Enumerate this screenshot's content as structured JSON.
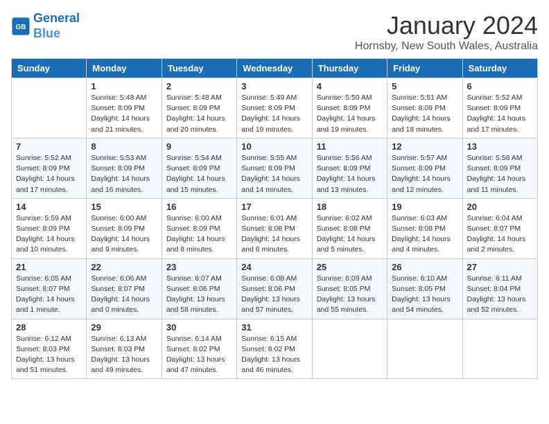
{
  "logo": {
    "line1": "General",
    "line2": "Blue"
  },
  "title": "January 2024",
  "subtitle": "Hornsby, New South Wales, Australia",
  "weekdays": [
    "Sunday",
    "Monday",
    "Tuesday",
    "Wednesday",
    "Thursday",
    "Friday",
    "Saturday"
  ],
  "weeks": [
    [
      {
        "day": "",
        "info": ""
      },
      {
        "day": "1",
        "info": "Sunrise: 5:48 AM\nSunset: 8:09 PM\nDaylight: 14 hours\nand 21 minutes."
      },
      {
        "day": "2",
        "info": "Sunrise: 5:48 AM\nSunset: 8:09 PM\nDaylight: 14 hours\nand 20 minutes."
      },
      {
        "day": "3",
        "info": "Sunrise: 5:49 AM\nSunset: 8:09 PM\nDaylight: 14 hours\nand 19 minutes."
      },
      {
        "day": "4",
        "info": "Sunrise: 5:50 AM\nSunset: 8:09 PM\nDaylight: 14 hours\nand 19 minutes."
      },
      {
        "day": "5",
        "info": "Sunrise: 5:51 AM\nSunset: 8:09 PM\nDaylight: 14 hours\nand 18 minutes."
      },
      {
        "day": "6",
        "info": "Sunrise: 5:52 AM\nSunset: 8:09 PM\nDaylight: 14 hours\nand 17 minutes."
      }
    ],
    [
      {
        "day": "7",
        "info": "Sunrise: 5:52 AM\nSunset: 8:09 PM\nDaylight: 14 hours\nand 17 minutes."
      },
      {
        "day": "8",
        "info": "Sunrise: 5:53 AM\nSunset: 8:09 PM\nDaylight: 14 hours\nand 16 minutes."
      },
      {
        "day": "9",
        "info": "Sunrise: 5:54 AM\nSunset: 8:09 PM\nDaylight: 14 hours\nand 15 minutes."
      },
      {
        "day": "10",
        "info": "Sunrise: 5:55 AM\nSunset: 8:09 PM\nDaylight: 14 hours\nand 14 minutes."
      },
      {
        "day": "11",
        "info": "Sunrise: 5:56 AM\nSunset: 8:09 PM\nDaylight: 14 hours\nand 13 minutes."
      },
      {
        "day": "12",
        "info": "Sunrise: 5:57 AM\nSunset: 8:09 PM\nDaylight: 14 hours\nand 12 minutes."
      },
      {
        "day": "13",
        "info": "Sunrise: 5:58 AM\nSunset: 8:09 PM\nDaylight: 14 hours\nand 11 minutes."
      }
    ],
    [
      {
        "day": "14",
        "info": "Sunrise: 5:59 AM\nSunset: 8:09 PM\nDaylight: 14 hours\nand 10 minutes."
      },
      {
        "day": "15",
        "info": "Sunrise: 6:00 AM\nSunset: 8:09 PM\nDaylight: 14 hours\nand 9 minutes."
      },
      {
        "day": "16",
        "info": "Sunrise: 6:00 AM\nSunset: 8:09 PM\nDaylight: 14 hours\nand 8 minutes."
      },
      {
        "day": "17",
        "info": "Sunrise: 6:01 AM\nSunset: 8:08 PM\nDaylight: 14 hours\nand 6 minutes."
      },
      {
        "day": "18",
        "info": "Sunrise: 6:02 AM\nSunset: 8:08 PM\nDaylight: 14 hours\nand 5 minutes."
      },
      {
        "day": "19",
        "info": "Sunrise: 6:03 AM\nSunset: 8:08 PM\nDaylight: 14 hours\nand 4 minutes."
      },
      {
        "day": "20",
        "info": "Sunrise: 6:04 AM\nSunset: 8:07 PM\nDaylight: 14 hours\nand 2 minutes."
      }
    ],
    [
      {
        "day": "21",
        "info": "Sunrise: 6:05 AM\nSunset: 8:07 PM\nDaylight: 14 hours\nand 1 minute."
      },
      {
        "day": "22",
        "info": "Sunrise: 6:06 AM\nSunset: 8:07 PM\nDaylight: 14 hours\nand 0 minutes."
      },
      {
        "day": "23",
        "info": "Sunrise: 6:07 AM\nSunset: 8:06 PM\nDaylight: 13 hours\nand 58 minutes."
      },
      {
        "day": "24",
        "info": "Sunrise: 6:08 AM\nSunset: 8:06 PM\nDaylight: 13 hours\nand 57 minutes."
      },
      {
        "day": "25",
        "info": "Sunrise: 6:09 AM\nSunset: 8:05 PM\nDaylight: 13 hours\nand 55 minutes."
      },
      {
        "day": "26",
        "info": "Sunrise: 6:10 AM\nSunset: 8:05 PM\nDaylight: 13 hours\nand 54 minutes."
      },
      {
        "day": "27",
        "info": "Sunrise: 6:11 AM\nSunset: 8:04 PM\nDaylight: 13 hours\nand 52 minutes."
      }
    ],
    [
      {
        "day": "28",
        "info": "Sunrise: 6:12 AM\nSunset: 8:03 PM\nDaylight: 13 hours\nand 51 minutes."
      },
      {
        "day": "29",
        "info": "Sunrise: 6:13 AM\nSunset: 8:03 PM\nDaylight: 13 hours\nand 49 minutes."
      },
      {
        "day": "30",
        "info": "Sunrise: 6:14 AM\nSunset: 8:02 PM\nDaylight: 13 hours\nand 47 minutes."
      },
      {
        "day": "31",
        "info": "Sunrise: 6:15 AM\nSunset: 8:02 PM\nDaylight: 13 hours\nand 46 minutes."
      },
      {
        "day": "",
        "info": ""
      },
      {
        "day": "",
        "info": ""
      },
      {
        "day": "",
        "info": ""
      }
    ]
  ]
}
